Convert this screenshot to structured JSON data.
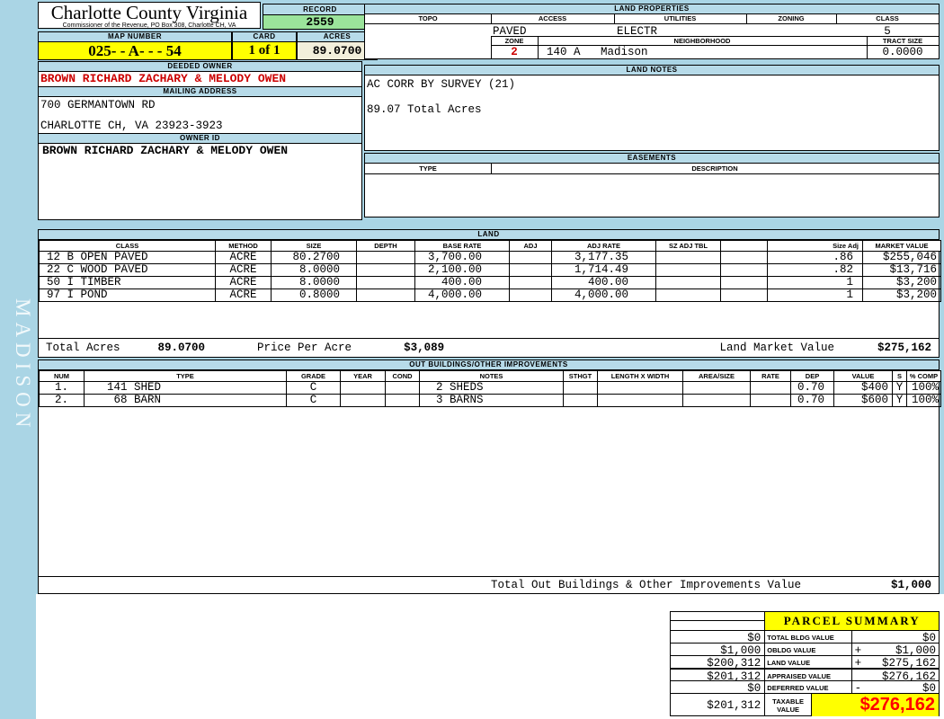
{
  "colors": {
    "page_bg": "#aad5e5",
    "bar_bg": "#b7dbe9",
    "record_green": "#9be49b",
    "highlight_yellow": "#ffff00",
    "acres_cream": "#f2efdb",
    "owner_red": "#cc0000",
    "taxable_red": "#ff0000"
  },
  "sidebar": {
    "district_label": "MADISON"
  },
  "header": {
    "county_title": "Charlotte County Virginia",
    "commissioner_line": "Commissioner of the Revenue, PO Box 308, Charlotte CH, VA",
    "record_label": "RECORD",
    "record_value": "2559",
    "map_number_label": "MAP NUMBER",
    "map_number_value": "025- - A- - - 54",
    "card_label": "CARD",
    "card_value": "1 of 1",
    "acres_label": "ACRES",
    "acres_value": "89.0700"
  },
  "land_properties": {
    "title": "LAND PROPERTIES",
    "topo_label": "TOPO",
    "access_label": "ACCESS",
    "utilities_label": "UTILITIES",
    "zoning_label": "ZONING",
    "class_label": "CLASS",
    "topo": "",
    "access": "PAVED",
    "utilities": "ELECTR",
    "zoning": "",
    "class": "5",
    "zone_label": "ZONE",
    "neighborhood_label": "NEIGHBORHOOD",
    "tract_size_label": "TRACT SIZE",
    "zone": "2",
    "neighborhood_code": "140 A",
    "neighborhood_name": "Madison",
    "tract_size": "0.0000"
  },
  "owner": {
    "deeded_owner_label": "DEEDED OWNER",
    "deeded_owner": "BROWN RICHARD ZACHARY & MELODY OWEN",
    "mailing_address_label": "MAILING ADDRESS",
    "address_line1": "700 GERMANTOWN RD",
    "address_line2": "CHARLOTTE CH, VA 23923-3923",
    "owner_id_label": "OWNER ID",
    "owner_id": "BROWN RICHARD ZACHARY & MELODY OWEN"
  },
  "land_notes": {
    "title": "LAND NOTES",
    "line1": "AC CORR BY SURVEY (21)",
    "line2": "89.07 Total Acres"
  },
  "easements": {
    "title": "EASEMENTS",
    "type_label": "TYPE",
    "description_label": "DESCRIPTION"
  },
  "land": {
    "title": "LAND",
    "columns": [
      "CLASS",
      "METHOD",
      "SIZE",
      "DEPTH",
      "BASE RATE",
      "ADJ",
      "ADJ RATE",
      "SZ ADJ TBL",
      "",
      "Size Adj",
      "MARKET VALUE"
    ],
    "rows": [
      {
        "class": "12 B OPEN PAVED",
        "method": "ACRE",
        "size": "80.2700",
        "depth": "",
        "base_rate": "3,700.00",
        "adj": "",
        "adj_rate": "3,177.35",
        "sz_adj_tbl": "",
        "blank": "",
        "size_adj": ".86",
        "market_value": "$255,046"
      },
      {
        "class": "22 C WOOD PAVED",
        "method": "ACRE",
        "size": "8.0000",
        "depth": "",
        "base_rate": "2,100.00",
        "adj": "",
        "adj_rate": "1,714.49",
        "sz_adj_tbl": "",
        "blank": "",
        "size_adj": ".82",
        "market_value": "$13,716"
      },
      {
        "class": "50 I TIMBER",
        "method": "ACRE",
        "size": "8.0000",
        "depth": "",
        "base_rate": "400.00",
        "adj": "",
        "adj_rate": "400.00",
        "sz_adj_tbl": "",
        "blank": "",
        "size_adj": "1",
        "market_value": "$3,200"
      },
      {
        "class": "97 I POND",
        "method": "ACRE",
        "size": "0.8000",
        "depth": "",
        "base_rate": "4,000.00",
        "adj": "",
        "adj_rate": "4,000.00",
        "sz_adj_tbl": "",
        "blank": "",
        "size_adj": "1",
        "market_value": "$3,200"
      }
    ],
    "total_acres_label": "Total Acres",
    "total_acres": "89.0700",
    "price_per_acre_label": "Price Per Acre",
    "price_per_acre": "$3,089",
    "market_value_label": "Land Market Value",
    "market_value_total": "$275,162"
  },
  "out_buildings": {
    "title": "OUT BUILDINGS/OTHER IMPROVEMENTS",
    "columns": [
      "NUM",
      "TYPE",
      "GRADE",
      "YEAR",
      "COND",
      "NOTES",
      "STHGT",
      "LENGTH X WIDTH",
      "AREA/SIZE",
      "RATE",
      "DEP",
      "VALUE",
      "S",
      "% COMP"
    ],
    "rows": [
      {
        "num": "1.",
        "type": "141 SHED",
        "grade": "C",
        "year": "",
        "cond": "",
        "notes": "2 SHEDS",
        "sthgt": "",
        "length_width": "",
        "area_size": "",
        "rate": "",
        "dep": "0.70",
        "value": "$400",
        "s": "Y",
        "pct_comp": "100%"
      },
      {
        "num": "2.",
        "type": " 68 BARN",
        "grade": "C",
        "year": "",
        "cond": "",
        "notes": "3 BARNS",
        "sthgt": "",
        "length_width": "",
        "area_size": "",
        "rate": "",
        "dep": "0.70",
        "value": "$600",
        "s": "Y",
        "pct_comp": "100%"
      }
    ],
    "total_label": "Total Out Buildings & Other Improvements Value",
    "total_value": "$1,000"
  },
  "parcel_summary": {
    "title": "PARCEL SUMMARY",
    "rows": [
      {
        "prev": "$0",
        "label": "TOTAL BLDG VALUE",
        "op": "",
        "value": "$0"
      },
      {
        "prev": "$1,000",
        "label": "OBLDG VALUE",
        "op": "+",
        "value": "$1,000"
      },
      {
        "prev": "$200,312",
        "label": "LAND VALUE",
        "op": "+",
        "value": "$275,162"
      },
      {
        "prev": "$201,312",
        "label": "APPRAISED VALUE",
        "op": "",
        "value": "$276,162"
      },
      {
        "prev": "$0",
        "label": "DEFERRED VALUE",
        "op": "-",
        "value": "$0"
      }
    ],
    "taxable": {
      "prev": "$201,312",
      "label": "TAXABLE VALUE",
      "value": "$276,162"
    }
  }
}
